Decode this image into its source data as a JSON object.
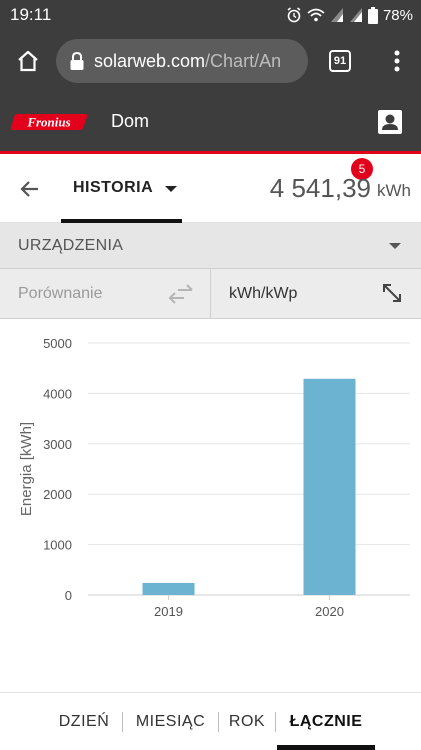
{
  "status_bar": {
    "time": "19:11",
    "battery": "78%",
    "icons": [
      "alarm-icon",
      "wifi-icon",
      "signal-icon",
      "signal-icon",
      "battery-icon"
    ]
  },
  "browser": {
    "url_host": "solarweb.com",
    "url_path": "/Chart/An",
    "tab_count": "91",
    "icons": [
      "home-icon",
      "lock-icon",
      "tabs-icon",
      "more-vert-icon"
    ]
  },
  "app": {
    "logo_text": "Fronius",
    "site_name": "Dom",
    "brand_color": "#e2001a",
    "header_color": "#3d3d3d"
  },
  "history": {
    "label": "HISTORIA",
    "badge": "5",
    "total_value": "4 541,39",
    "total_unit": "kWh"
  },
  "devices": {
    "label": "URZĄDZENIA"
  },
  "compare": {
    "label": "Porównanie",
    "unit_label": "kWh/kWp"
  },
  "chart_data": {
    "type": "bar",
    "categories": [
      "2019",
      "2020"
    ],
    "values": [
      240,
      4290
    ],
    "ylabel": "Energia [kWh]",
    "ylim": [
      0,
      5000
    ],
    "yticks": [
      0,
      1000,
      2000,
      3000,
      4000,
      5000
    ],
    "bar_color": "#6cb2d1",
    "grid": true
  },
  "period_tabs": [
    {
      "label": "DZIEŃ",
      "active": false
    },
    {
      "label": "MIESIĄC",
      "active": false
    },
    {
      "label": "ROK",
      "active": false
    },
    {
      "label": "ŁĄCZNIE",
      "active": true
    }
  ]
}
